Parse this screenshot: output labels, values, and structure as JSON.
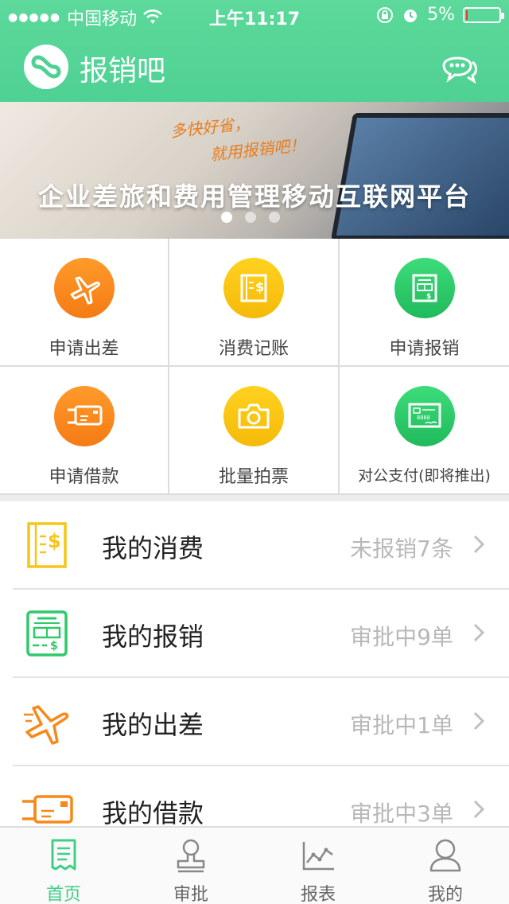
{
  "status_bar": {
    "signal": "●●●●●",
    "carrier": "中国移动",
    "time": "上午11:17",
    "battery": "5%",
    "battery_level": 0.05
  },
  "header": {
    "title": "报销吧",
    "logo_icon": "infinity-logo-icon",
    "chat_icon": "chat-bubbles-icon"
  },
  "banner": {
    "slogan_line1": "多快好省，",
    "slogan_line2": "就用报销吧！",
    "headline": "企业差旅和费用管理移动互联网平台",
    "page_count": 3,
    "active_page": 1
  },
  "quick_actions": [
    {
      "label": "申请出差",
      "icon": "airplane-icon",
      "color": "#f57b14"
    },
    {
      "label": "消费记账",
      "icon": "receipt-dollar-icon",
      "color": "#f5b909"
    },
    {
      "label": "申请报销",
      "icon": "reimburse-form-icon",
      "color": "#1fba5b"
    },
    {
      "label": "申请借款",
      "icon": "loan-card-icon",
      "color": "#f57b14"
    },
    {
      "label": "批量拍票",
      "icon": "camera-icon",
      "color": "#f5b909"
    },
    {
      "label": "对公支付(即将推出)",
      "icon": "check-payment-icon",
      "color": "#1fba5b"
    }
  ],
  "my_list": [
    {
      "title": "我的消费",
      "status": "未报销7条",
      "icon": "receipt-dollar-icon"
    },
    {
      "title": "我的报销",
      "status": "审批中9单",
      "icon": "reimburse-form-icon"
    },
    {
      "title": "我的出差",
      "status": "审批中1单",
      "icon": "airplane-icon"
    },
    {
      "title": "我的借款",
      "status": "审批中3单",
      "icon": "loan-card-icon"
    }
  ],
  "tabbar": [
    {
      "label": "首页",
      "icon": "home-doc-icon",
      "active": true
    },
    {
      "label": "审批",
      "icon": "approval-stamp-icon",
      "active": false
    },
    {
      "label": "报表",
      "icon": "chart-line-icon",
      "active": false
    },
    {
      "label": "我的",
      "icon": "person-icon",
      "active": false
    }
  ],
  "colors": {
    "brand_green": "#4fd193",
    "active_tab": "#3fcf86",
    "status_text": "#b8b8b8"
  }
}
